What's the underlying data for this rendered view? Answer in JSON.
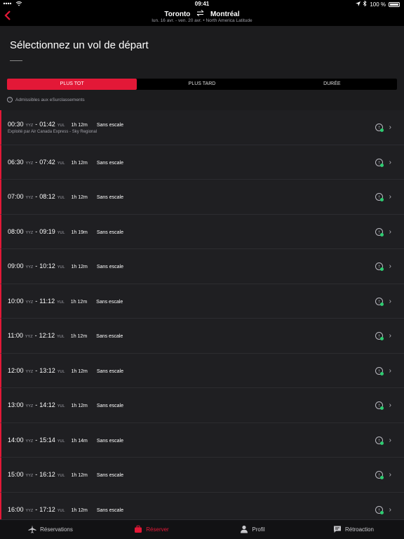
{
  "status_bar": {
    "time": "09:41",
    "battery": "100 %"
  },
  "nav": {
    "origin": "Toronto",
    "swap_icon": "swap-arrows-icon",
    "destination": "Montréal",
    "subtitle": "lun. 16 avr. - ven. 20 avr.  •  North America  Latitude"
  },
  "page": {
    "title": "Sélectionnez un vol de départ"
  },
  "sort_tabs": [
    {
      "label": "PLUS TOT",
      "active": true
    },
    {
      "label": "PLUS TARD",
      "active": false
    },
    {
      "label": "DURÉE",
      "active": false
    }
  ],
  "eligible_note": "Admissibles aux eSurclassements",
  "flights": [
    {
      "dep": "00:30",
      "dep_code": "YYZ",
      "arr": "01:42",
      "arr_code": "YUL",
      "duration": "1h 12m",
      "stops": "Sans escale",
      "operator": "Exploité par Air Canada Express - Sky Regional"
    },
    {
      "dep": "06:30",
      "dep_code": "YYZ",
      "arr": "07:42",
      "arr_code": "YUL",
      "duration": "1h 12m",
      "stops": "Sans escale",
      "operator": ""
    },
    {
      "dep": "07:00",
      "dep_code": "YYZ",
      "arr": "08:12",
      "arr_code": "YUL",
      "duration": "1h 12m",
      "stops": "Sans escale",
      "operator": ""
    },
    {
      "dep": "08:00",
      "dep_code": "YYZ",
      "arr": "09:19",
      "arr_code": "YUL",
      "duration": "1h 19m",
      "stops": "Sans escale",
      "operator": ""
    },
    {
      "dep": "09:00",
      "dep_code": "YYZ",
      "arr": "10:12",
      "arr_code": "YUL",
      "duration": "1h 12m",
      "stops": "Sans escale",
      "operator": ""
    },
    {
      "dep": "10:00",
      "dep_code": "YYZ",
      "arr": "11:12",
      "arr_code": "YUL",
      "duration": "1h 12m",
      "stops": "Sans escale",
      "operator": ""
    },
    {
      "dep": "11:00",
      "dep_code": "YYZ",
      "arr": "12:12",
      "arr_code": "YUL",
      "duration": "1h 12m",
      "stops": "Sans escale",
      "operator": ""
    },
    {
      "dep": "12:00",
      "dep_code": "YYZ",
      "arr": "13:12",
      "arr_code": "YUL",
      "duration": "1h 12m",
      "stops": "Sans escale",
      "operator": ""
    },
    {
      "dep": "13:00",
      "dep_code": "YYZ",
      "arr": "14:12",
      "arr_code": "YUL",
      "duration": "1h 12m",
      "stops": "Sans escale",
      "operator": ""
    },
    {
      "dep": "14:00",
      "dep_code": "YYZ",
      "arr": "15:14",
      "arr_code": "YUL",
      "duration": "1h 14m",
      "stops": "Sans escale",
      "operator": ""
    },
    {
      "dep": "15:00",
      "dep_code": "YYZ",
      "arr": "16:12",
      "arr_code": "YUL",
      "duration": "1h 12m",
      "stops": "Sans escale",
      "operator": ""
    },
    {
      "dep": "16:00",
      "dep_code": "YYZ",
      "arr": "17:12",
      "arr_code": "YUL",
      "duration": "1h 12m",
      "stops": "Sans escale",
      "operator": ""
    }
  ],
  "tab_bar": [
    {
      "label": "Réservations",
      "icon": "airplane-icon",
      "active": false
    },
    {
      "label": "Réserver",
      "icon": "suitcase-icon",
      "active": true
    },
    {
      "label": "Profil",
      "icon": "person-icon",
      "active": false
    },
    {
      "label": "Rétroaction",
      "icon": "feedback-icon",
      "active": false
    }
  ],
  "colors": {
    "accent": "#e31837",
    "upgrade_dot": "#2ecc71",
    "background": "#1c1c1e"
  }
}
